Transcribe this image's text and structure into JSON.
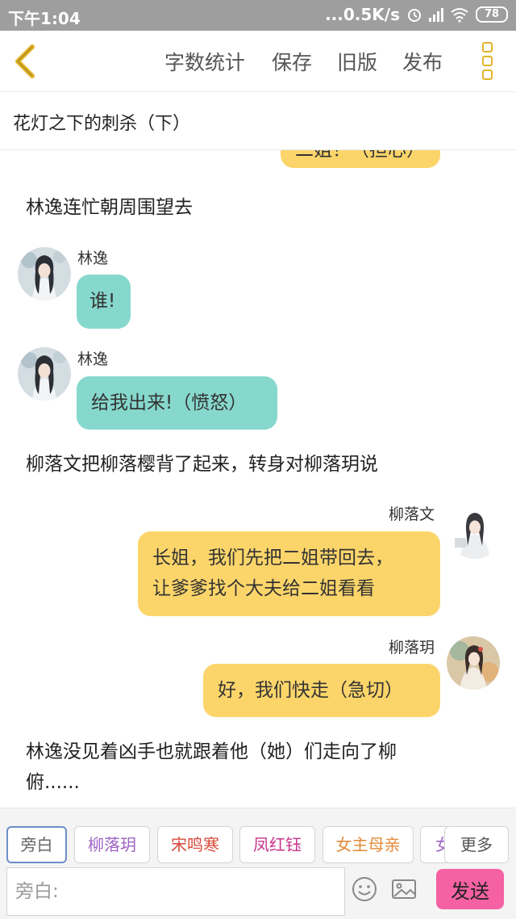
{
  "status_bar": {
    "time": "下午1:04",
    "network_speed": "...0.5K/s",
    "battery": "78"
  },
  "toolbar": {
    "word_count": "字数统计",
    "save": "保存",
    "old_version": "旧版",
    "publish": "发布"
  },
  "chapter_title": "花灯之下的刺杀（下）",
  "messages": {
    "partial_top": "二姐！（担心）",
    "narration_1": "林逸连忙朝周围望去",
    "msg_1": {
      "speaker": "林逸",
      "text": "谁!"
    },
    "msg_2": {
      "speaker": "林逸",
      "text": "给我出来!（愤怒）"
    },
    "narration_2": "柳落文把柳落樱背了起来，转身对柳落玥说",
    "msg_3": {
      "speaker": "柳落文",
      "line1": "长姐，我们先把二姐带回去，",
      "line2": "让爹爹找个大夫给二姐看看"
    },
    "msg_4": {
      "speaker": "柳落玥",
      "text": "好，我们快走（急切）"
    },
    "narration_3_line1": "林逸没见着凶手也就跟着他（她）们走向了柳",
    "narration_3_line2": "俯......"
  },
  "role_tags": {
    "items": [
      "旁白",
      "柳落玥",
      "宋鸣寒",
      "凤红钰",
      "女主母亲",
      "女"
    ],
    "colors": [
      "#666666",
      "#a065c4",
      "#d84a3a",
      "#c8358c",
      "#e58b3a",
      "#a065c4"
    ],
    "more": "更多"
  },
  "input": {
    "placeholder": "旁白:",
    "send": "发送"
  },
  "colors": {
    "accent_yellow": "#fcd56a",
    "bubble_teal": "#86d8cd",
    "send_pink": "#f561a3",
    "back_arrow": "#e3b52a"
  },
  "icons": [
    "back-arrow-icon",
    "more-menu-icon",
    "emoji-icon",
    "image-icon",
    "wifi-icon",
    "signal-icon",
    "alarm-icon",
    "battery-icon"
  ]
}
